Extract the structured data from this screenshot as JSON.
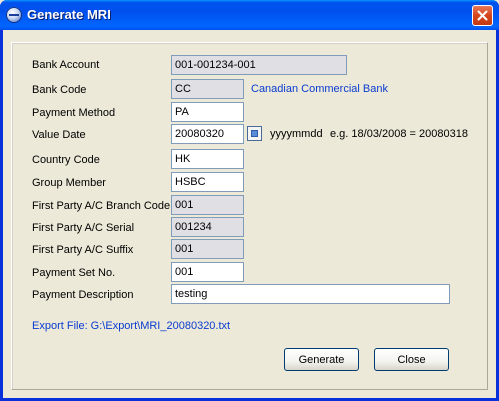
{
  "window": {
    "title": "Generate MRI"
  },
  "icons": {
    "app": "mri-app-icon",
    "close": "close-icon",
    "date_picker": "calendar-icon"
  },
  "colors": {
    "titlebar": "#0054e3",
    "link_text": "#0a3bd1",
    "readonly_field": "#e0dfe3"
  },
  "form": {
    "bank_account": {
      "label": "Bank Account",
      "value": "001-001234-001"
    },
    "bank_code": {
      "label": "Bank Code",
      "value": "CC",
      "bank_name": "Canadian Commercial Bank"
    },
    "payment_method": {
      "label": "Payment Method",
      "value": "PA"
    },
    "value_date": {
      "label": "Value Date",
      "value": "20080320",
      "format_hint": "yyyymmdd",
      "format_example": "e.g. 18/03/2008 = 20080318"
    },
    "country_code": {
      "label": "Country Code",
      "value": "HK"
    },
    "group_member": {
      "label": "Group Member",
      "value": "HSBC"
    },
    "branch_code": {
      "label": "First Party A/C Branch Code",
      "value": "001"
    },
    "serial": {
      "label": "First Party A/C Serial",
      "value": "001234"
    },
    "suffix": {
      "label": "First Party A/C Suffix",
      "value": "001"
    },
    "payment_set_no": {
      "label": "Payment Set No.",
      "value": "001"
    },
    "payment_description": {
      "label": "Payment Description",
      "value": "testing"
    }
  },
  "export_file": "Export File: G:\\Export\\MRI_20080320.txt",
  "buttons": {
    "generate": "Generate",
    "close": "Close"
  }
}
